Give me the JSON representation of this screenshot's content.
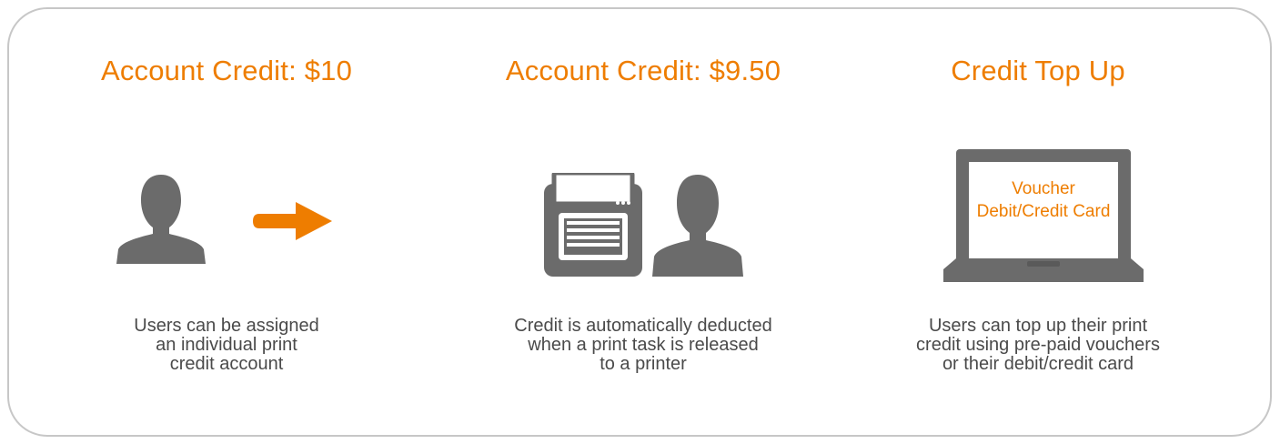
{
  "colors": {
    "accent": "#ee7d00",
    "icon": "#6b6b6b",
    "text": "#4a4a4a",
    "border": "#c7c7c7"
  },
  "steps": [
    {
      "title": "Account Credit: $10",
      "icons": [
        "user-icon",
        "arrow-right-icon"
      ],
      "description": [
        "Users can be assigned",
        "an individual print",
        "credit account"
      ]
    },
    {
      "title": "Account Credit: $9.50",
      "icons": [
        "printer-icon",
        "user-icon"
      ],
      "description": [
        "Credit is automatically deducted",
        "when a print task is released",
        "to a printer"
      ]
    },
    {
      "title": "Credit Top Up",
      "icons": [
        "laptop-icon"
      ],
      "screen": [
        "Voucher",
        "Debit/Credit Card"
      ],
      "description": [
        "Users can top up their print",
        "credit using pre-paid vouchers",
        "or their debit/credit card"
      ]
    }
  ]
}
